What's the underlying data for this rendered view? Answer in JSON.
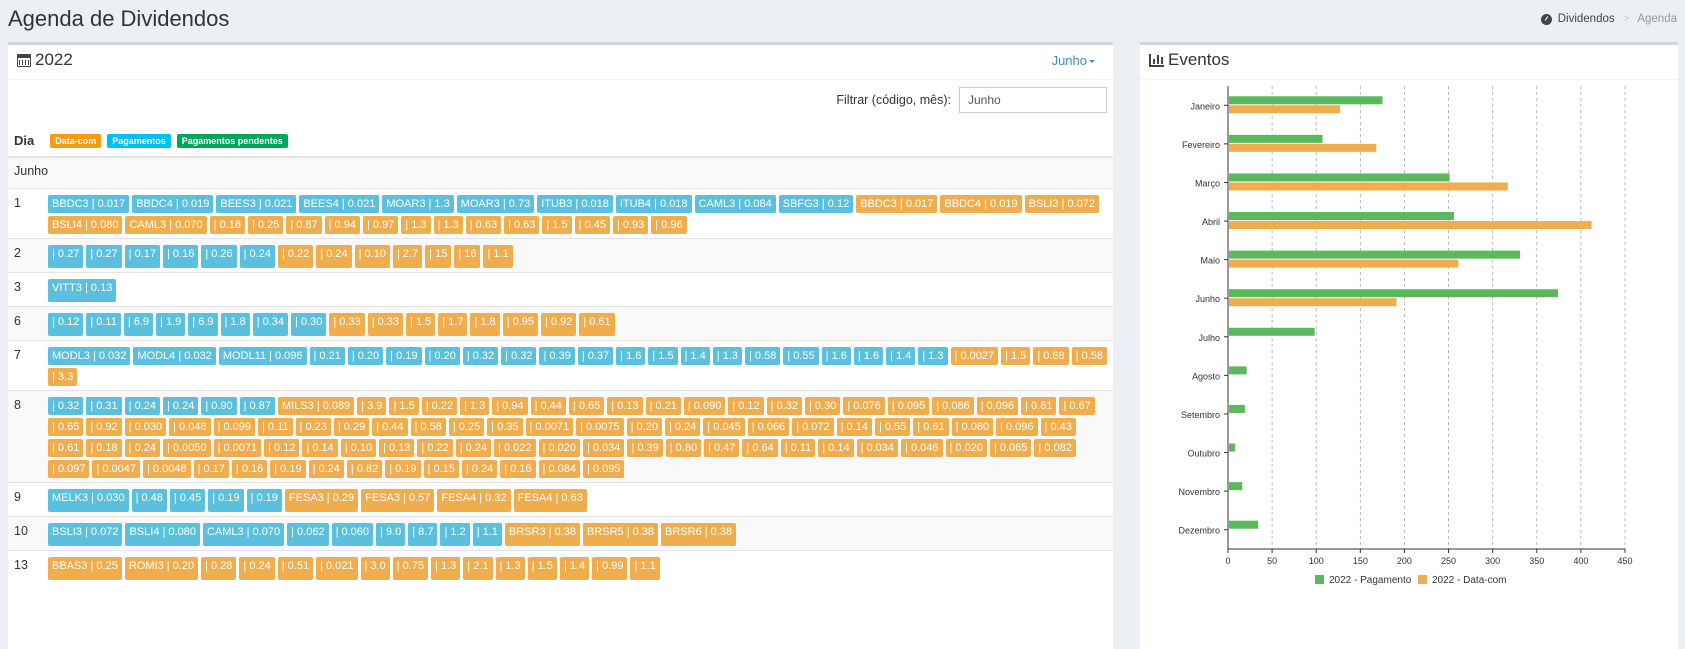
{
  "page": {
    "title": "Agenda de Dividendos"
  },
  "breadcrumb": {
    "home": "Dividendos",
    "sep": ">",
    "current": "Agenda"
  },
  "calendar": {
    "year": "2022",
    "month_dropdown": "Junho",
    "filter_label": "Filtrar (código, mês):",
    "filter_value": "Junho",
    "legend": {
      "day": "Dia",
      "datacom": "Data-com",
      "pagamentos": "Pagamentos",
      "pendentes": "Pagamentos pendentes"
    },
    "month_header": "Junho",
    "colors": {
      "datacom": "#f0ad4e",
      "pagamentos": "#5bc0de",
      "pendentes": "#00a65a"
    },
    "rows": [
      {
        "day": "1",
        "tags": [
          [
            "b",
            "BBDC3 | 0.017"
          ],
          [
            "b",
            "BBDC4 | 0.019"
          ],
          [
            "b",
            "BEES3 | 0.021"
          ],
          [
            "b",
            "BEES4 | 0.021"
          ],
          [
            "b",
            "MOAR3 | 1.3"
          ],
          [
            "b",
            "MOAR3 | 0.73"
          ],
          [
            "b",
            "ITUB3 | 0.018"
          ],
          [
            "b",
            "ITUB4 | 0.018"
          ],
          [
            "b",
            "CAML3 | 0.084"
          ],
          [
            "b",
            "SBFG3 | 0.12"
          ],
          [
            "o",
            "BBDC3 | 0.017"
          ],
          [
            "o",
            "BBDC4 | 0.019"
          ],
          [
            "o",
            "BSLI3 | 0.072"
          ],
          [
            "o",
            "BSLI4 | 0.080"
          ],
          [
            "o",
            "CAML3 | 0.070"
          ],
          [
            "o",
            "| 0.18"
          ],
          [
            "o",
            "| 0.25"
          ],
          [
            "o",
            "| 0.87"
          ],
          [
            "o",
            "| 0.94"
          ],
          [
            "o",
            "| 0.97"
          ],
          [
            "o",
            "| 1.3"
          ],
          [
            "o",
            "| 1.3"
          ],
          [
            "o",
            "| 0.63"
          ],
          [
            "o",
            "| 0.63"
          ],
          [
            "o",
            "| 1.5"
          ],
          [
            "o",
            "| 0.45"
          ],
          [
            "o",
            "| 0.93"
          ],
          [
            "o",
            "| 0.96"
          ]
        ]
      },
      {
        "day": "2",
        "tags": [
          [
            "b",
            "| 0.27"
          ],
          [
            "b",
            "| 0.27"
          ],
          [
            "b",
            "| 0.17"
          ],
          [
            "b",
            "| 0.16"
          ],
          [
            "b",
            "| 0.26"
          ],
          [
            "b",
            "| 0.24"
          ],
          [
            "o",
            "| 0.22"
          ],
          [
            "o",
            "| 0.24"
          ],
          [
            "o",
            "| 0.10"
          ],
          [
            "o",
            "| 2.7"
          ],
          [
            "o",
            "| 15"
          ],
          [
            "o",
            "| 16"
          ],
          [
            "o",
            "| 1.1"
          ]
        ]
      },
      {
        "day": "3",
        "tags": [
          [
            "b",
            "VITT3 | 0.13"
          ]
        ]
      },
      {
        "day": "6",
        "tags": [
          [
            "b",
            "| 0.12"
          ],
          [
            "b",
            "| 0.11"
          ],
          [
            "b",
            "| 6.9"
          ],
          [
            "b",
            "| 1.9"
          ],
          [
            "b",
            "| 6.9"
          ],
          [
            "b",
            "| 1.8"
          ],
          [
            "b",
            "| 0.34"
          ],
          [
            "b",
            "| 0.30"
          ],
          [
            "o",
            "| 0.33"
          ],
          [
            "o",
            "| 0.33"
          ],
          [
            "o",
            "| 1.5"
          ],
          [
            "o",
            "| 1.7"
          ],
          [
            "o",
            "| 1.8"
          ],
          [
            "o",
            "| 0.95"
          ],
          [
            "o",
            "| 0.92"
          ],
          [
            "o",
            "| 0.61"
          ]
        ]
      },
      {
        "day": "7",
        "tags": [
          [
            "b",
            "MODL3 | 0.032"
          ],
          [
            "b",
            "MODL4 | 0.032"
          ],
          [
            "b",
            "MODL11 | 0.096"
          ],
          [
            "b",
            "| 0.21"
          ],
          [
            "b",
            "| 0.20"
          ],
          [
            "b",
            "| 0.19"
          ],
          [
            "b",
            "| 0.20"
          ],
          [
            "b",
            "| 0.32"
          ],
          [
            "b",
            "| 0.32"
          ],
          [
            "b",
            "| 0.39"
          ],
          [
            "b",
            "| 0.37"
          ],
          [
            "b",
            "| 1.6"
          ],
          [
            "b",
            "| 1.5"
          ],
          [
            "b",
            "| 1.4"
          ],
          [
            "b",
            "| 1.3"
          ],
          [
            "b",
            "| 0.58"
          ],
          [
            "b",
            "| 0.55"
          ],
          [
            "b",
            "| 1.6"
          ],
          [
            "b",
            "| 1.6"
          ],
          [
            "b",
            "| 1.4"
          ],
          [
            "b",
            "| 1.3"
          ],
          [
            "o",
            "| 0.0027"
          ],
          [
            "o",
            "| 1.5"
          ],
          [
            "o",
            "| 0.68"
          ],
          [
            "o",
            "| 0.58"
          ],
          [
            "o",
            "| 3.3"
          ]
        ]
      },
      {
        "day": "8",
        "tags": [
          [
            "b",
            "| 0.32"
          ],
          [
            "b",
            "| 0.31"
          ],
          [
            "b",
            "| 0.24"
          ],
          [
            "b",
            "| 0.24"
          ],
          [
            "b",
            "| 0.90"
          ],
          [
            "b",
            "| 0.87"
          ],
          [
            "o",
            "MILS3 | 0.089"
          ],
          [
            "o",
            "| 3.9"
          ],
          [
            "o",
            "| 1.5"
          ],
          [
            "o",
            "| 0.22"
          ],
          [
            "o",
            "| 1.3"
          ],
          [
            "o",
            "| 0.94"
          ],
          [
            "o",
            "| 0.44"
          ],
          [
            "o",
            "| 0.65"
          ],
          [
            "o",
            "| 0.13"
          ],
          [
            "o",
            "| 0.21"
          ],
          [
            "o",
            "| 0.090"
          ],
          [
            "o",
            "| 0.12"
          ],
          [
            "o",
            "| 0.32"
          ],
          [
            "o",
            "| 0.30"
          ],
          [
            "o",
            "| 0.076"
          ],
          [
            "o",
            "| 0.095"
          ],
          [
            "o",
            "| 0.086"
          ],
          [
            "o",
            "| 0.096"
          ],
          [
            "o",
            "| 0.61"
          ],
          [
            "o",
            "| 0.67"
          ],
          [
            "o",
            "| 0.65"
          ],
          [
            "o",
            "| 0.92"
          ],
          [
            "o",
            "| 0.030"
          ],
          [
            "o",
            "| 0.048"
          ],
          [
            "o",
            "| 0.099"
          ],
          [
            "o",
            "| 0.11"
          ],
          [
            "o",
            "| 0.23"
          ],
          [
            "o",
            "| 0.29"
          ],
          [
            "o",
            "| 0.44"
          ],
          [
            "o",
            "| 0.58"
          ],
          [
            "o",
            "| 0.25"
          ],
          [
            "o",
            "| 0.35"
          ],
          [
            "o",
            "| 0.0071"
          ],
          [
            "o",
            "| 0.0075"
          ],
          [
            "o",
            "| 0.20"
          ],
          [
            "o",
            "| 0.24"
          ],
          [
            "o",
            "| 0.045"
          ],
          [
            "o",
            "| 0.066"
          ],
          [
            "o",
            "| 0.072"
          ],
          [
            "o",
            "| 0.14"
          ],
          [
            "o",
            "| 0.55"
          ],
          [
            "o",
            "| 0.61"
          ],
          [
            "o",
            "| 0.080"
          ],
          [
            "o",
            "| 0.096"
          ],
          [
            "o",
            "| 0.43"
          ],
          [
            "o",
            "| 0.61"
          ],
          [
            "o",
            "| 0.18"
          ],
          [
            "o",
            "| 0.24"
          ],
          [
            "o",
            "| 0.0050"
          ],
          [
            "o",
            "| 0.0071"
          ],
          [
            "o",
            "| 0.12"
          ],
          [
            "o",
            "| 0.14"
          ],
          [
            "o",
            "| 0.10"
          ],
          [
            "o",
            "| 0.13"
          ],
          [
            "o",
            "| 0.22"
          ],
          [
            "o",
            "| 0.24"
          ],
          [
            "o",
            "| 0.022"
          ],
          [
            "o",
            "| 0.020"
          ],
          [
            "o",
            "| 0.034"
          ],
          [
            "o",
            "| 0.39"
          ],
          [
            "o",
            "| 0.80"
          ],
          [
            "o",
            "| 0.47"
          ],
          [
            "o",
            "| 0.64"
          ],
          [
            "o",
            "| 0.11"
          ],
          [
            "o",
            "| 0.14"
          ],
          [
            "o",
            "| 0.034"
          ],
          [
            "o",
            "| 0.046"
          ],
          [
            "o",
            "| 0.020"
          ],
          [
            "o",
            "| 0.065"
          ],
          [
            "o",
            "| 0.082"
          ],
          [
            "o",
            "| 0.097"
          ],
          [
            "o",
            "| 0.0047"
          ],
          [
            "o",
            "| 0.0048"
          ],
          [
            "o",
            "| 0.17"
          ],
          [
            "o",
            "| 0.16"
          ],
          [
            "o",
            "| 0.19"
          ],
          [
            "o",
            "| 0.24"
          ],
          [
            "o",
            "| 0.82"
          ],
          [
            "o",
            "| 0.19"
          ],
          [
            "o",
            "| 0.15"
          ],
          [
            "o",
            "| 0.24"
          ],
          [
            "o",
            "| 0.16"
          ],
          [
            "o",
            "| 0.084"
          ],
          [
            "o",
            "| 0.095"
          ]
        ]
      },
      {
        "day": "9",
        "tags": [
          [
            "b",
            "MELK3 | 0.030"
          ],
          [
            "b",
            "| 0.48"
          ],
          [
            "b",
            "| 0.45"
          ],
          [
            "b",
            "| 0.19"
          ],
          [
            "b",
            "| 0.19"
          ],
          [
            "o",
            "FESA3 | 0.29"
          ],
          [
            "o",
            "FESA3 | 0.57"
          ],
          [
            "o",
            "FESA4 | 0.32"
          ],
          [
            "o",
            "FESA4 | 0.63"
          ]
        ]
      },
      {
        "day": "10",
        "tags": [
          [
            "b",
            "BSLI3 | 0.072"
          ],
          [
            "b",
            "BSLI4 | 0.080"
          ],
          [
            "b",
            "CAML3 | 0.070"
          ],
          [
            "b",
            "| 0.062"
          ],
          [
            "b",
            "| 0.060"
          ],
          [
            "b",
            "| 9.0"
          ],
          [
            "b",
            "| 8.7"
          ],
          [
            "b",
            "| 1.2"
          ],
          [
            "b",
            "| 1.1"
          ],
          [
            "o",
            "BRSR3 | 0.38"
          ],
          [
            "o",
            "BRSR5 | 0.38"
          ],
          [
            "o",
            "BRSR6 | 0.38"
          ]
        ]
      },
      {
        "day": "13",
        "tags": [
          [
            "o",
            "BBAS3 | 0.25"
          ],
          [
            "o",
            "ROMI3 | 0.20"
          ],
          [
            "o",
            "| 0.28"
          ],
          [
            "o",
            "| 0.24"
          ],
          [
            "o",
            "| 0.51"
          ],
          [
            "o",
            "| 0.021"
          ],
          [
            "o",
            "| 3.0"
          ],
          [
            "o",
            "| 0.75"
          ],
          [
            "o",
            "| 1.3"
          ],
          [
            "o",
            "| 2.1"
          ],
          [
            "o",
            "| 1.3"
          ],
          [
            "o",
            "| 1.5"
          ],
          [
            "o",
            "| 1.4"
          ],
          [
            "o",
            "| 0.99"
          ],
          [
            "o",
            "| 1.1"
          ]
        ]
      }
    ]
  },
  "events": {
    "title": "Eventos",
    "chart_data": {
      "type": "bar",
      "orientation": "horizontal",
      "categories": [
        "Janeiro",
        "Fevereiro",
        "Março",
        "Abril",
        "Maio",
        "Junho",
        "Julho",
        "Agosto",
        "Setembro",
        "Outubro",
        "Novembro",
        "Dezembro"
      ],
      "series": [
        {
          "name": "2022 - Pagamento",
          "color": "#5cb85c",
          "values": [
            174,
            106,
            250,
            255,
            330,
            373,
            97,
            20,
            18,
            7,
            15,
            33
          ]
        },
        {
          "name": "2022 - Data-com",
          "color": "#f0ad4e",
          "values": [
            126,
            167,
            316,
            411,
            260,
            190,
            0,
            0,
            0,
            0,
            0,
            0
          ]
        }
      ],
      "xticks": [
        "0",
        "50",
        "100",
        "150",
        "200",
        "250",
        "300",
        "350",
        "400",
        "450"
      ],
      "xlim": [
        0,
        450
      ],
      "grid": true,
      "legend_position": "bottom"
    }
  }
}
